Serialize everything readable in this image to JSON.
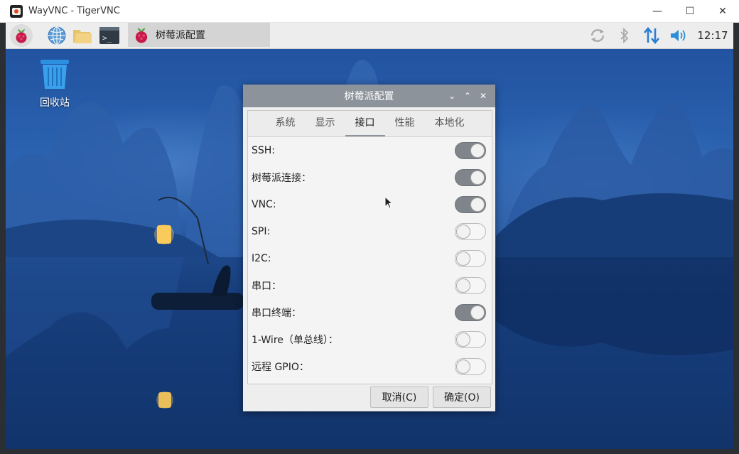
{
  "host_window": {
    "title": "WayVNC - TigerVNC",
    "minimize_glyph": "—",
    "maximize_glyph": "☐",
    "close_glyph": "✕"
  },
  "panel": {
    "task_title": "树莓派配置",
    "clock": "12:17",
    "icons": [
      "raspberry-menu-icon",
      "web-browser-icon",
      "file-manager-icon",
      "terminal-icon",
      "sync-icon",
      "bluetooth-icon",
      "network-icon",
      "volume-icon"
    ],
    "terminal_glyph": ">_"
  },
  "desktop": {
    "trash_label": "回收站"
  },
  "dialog": {
    "title": "树莓派配置",
    "controls": {
      "minimize": "⌄",
      "maximize": "⌃",
      "close": "✕"
    },
    "tabs": [
      "系统",
      "显示",
      "接口",
      "性能",
      "本地化"
    ],
    "active_tab": "接口",
    "settings": [
      {
        "label": "SSH:",
        "enabled": true
      },
      {
        "label": "树莓派连接：",
        "enabled": true
      },
      {
        "label": "VNC:",
        "enabled": true
      },
      {
        "label": "SPI:",
        "enabled": false
      },
      {
        "label": "I2C:",
        "enabled": false
      },
      {
        "label": "串口：",
        "enabled": false
      },
      {
        "label": "串口终端：",
        "enabled": true
      },
      {
        "label": "1-Wire（单总线）：",
        "enabled": false
      },
      {
        "label": "远程 GPIO：",
        "enabled": false
      }
    ],
    "buttons": {
      "cancel": "取消(C)",
      "ok": "确定(O)"
    }
  },
  "colors": {
    "switch_on": "#7f858b",
    "title_bar": "#8c939a",
    "panel": "#ededed",
    "network_arrows": "#2a7fd4"
  }
}
